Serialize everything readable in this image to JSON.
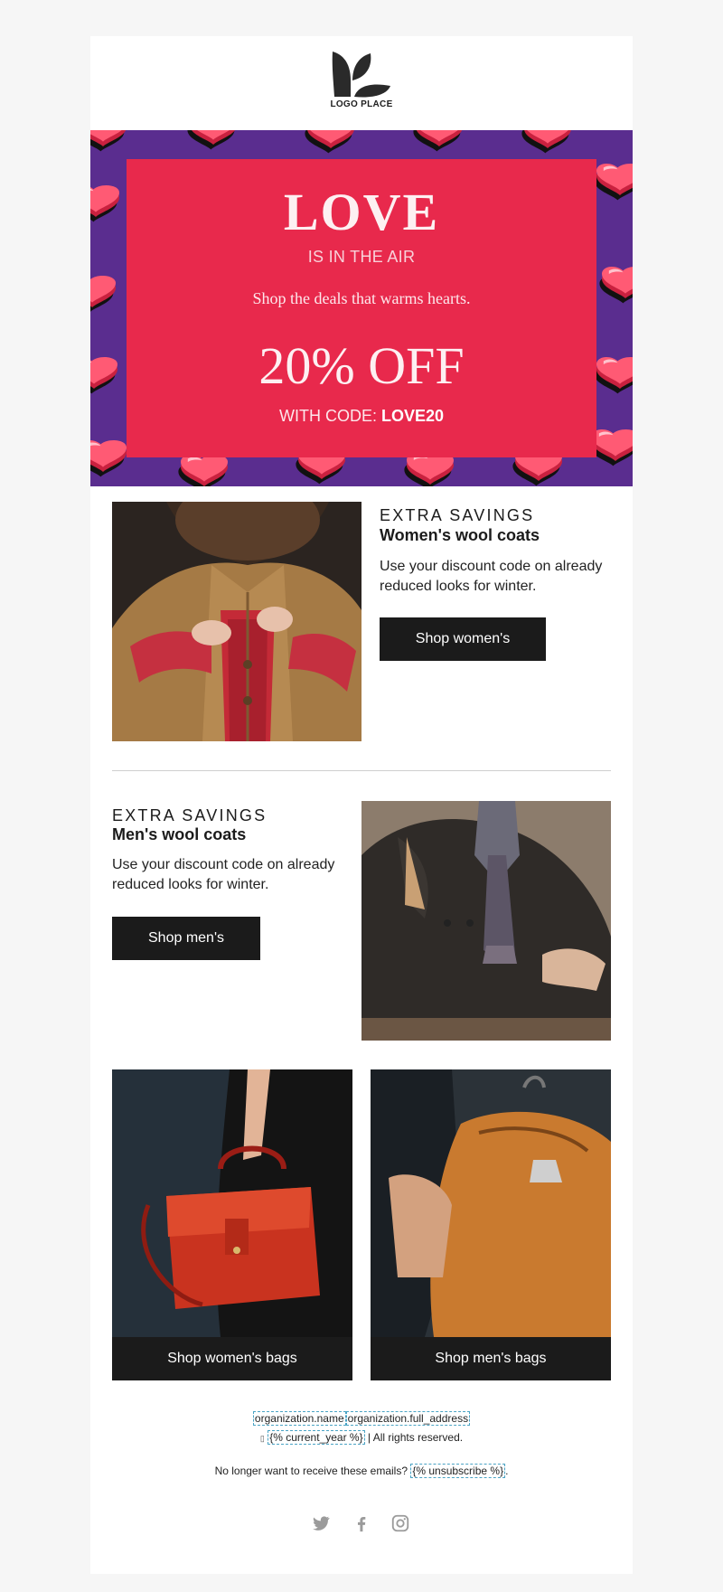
{
  "logo": {
    "text": "LOGO PLACE"
  },
  "hero": {
    "title": "LOVE",
    "subtitle": "IS IN THE AIR",
    "tagline": "Shop the deals that warms hearts.",
    "offer": "20% OFF",
    "code_prefix": "WITH CODE: ",
    "code": "LOVE20"
  },
  "women": {
    "eyebrow": "EXTRA SAVINGS",
    "headline": "Women's wool coats",
    "body": "Use your discount code on already reduced looks for winter.",
    "button": "Shop women's"
  },
  "men": {
    "eyebrow": "EXTRA SAVINGS",
    "headline": "Men's wool coats",
    "body": "Use your discount code on already reduced looks for winter.",
    "button": "Shop men's"
  },
  "bags": {
    "women_button": "Shop women's bags",
    "men_button": "Shop men's bags"
  },
  "footer": {
    "org_name": "organization.name",
    "org_address": "organization.full_address",
    "year": "{% current_year %}",
    "rights": " | All rights reserved.",
    "unsubscribe_prompt": "No longer want to receive these emails? ",
    "unsubscribe": "{% unsubscribe %}",
    "period": "."
  },
  "social": [
    "twitter-icon",
    "facebook-icon",
    "instagram-icon"
  ],
  "colors": {
    "hero_card": "#e8294c",
    "hero_bg": "#5a2d8f",
    "button": "#1b1b1b",
    "page_bg": "#f6f6f6"
  }
}
